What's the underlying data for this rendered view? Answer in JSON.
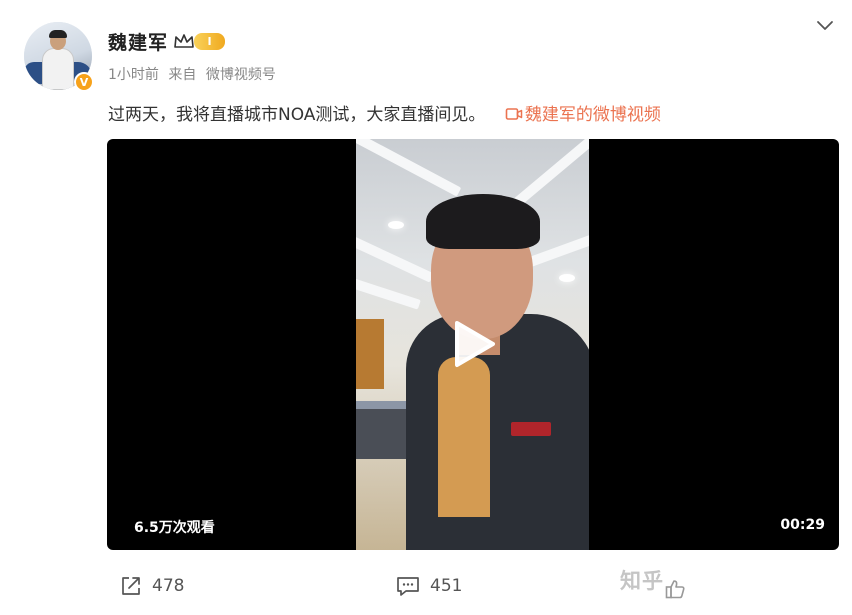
{
  "post": {
    "author_name": "魏建军",
    "level_label": "I",
    "verified_mark": "V",
    "meta": {
      "time": "1小时前",
      "source_prefix": "来自",
      "source": "微博视频号"
    },
    "text": "过两天，我将直播城市NOA测试，大家直播间见。",
    "video_link": "魏建军的微博视频",
    "accent_color": "#eb7350"
  },
  "video": {
    "views": "6.5万次观看",
    "duration": "00:29"
  },
  "actions": {
    "repost_count": "478",
    "comment_count": "451"
  },
  "watermark": "知乎",
  "icons": [
    "chevron-down-icon",
    "crown-icon",
    "video-link-icon",
    "play-icon",
    "repost-icon",
    "comment-icon",
    "like-icon"
  ]
}
